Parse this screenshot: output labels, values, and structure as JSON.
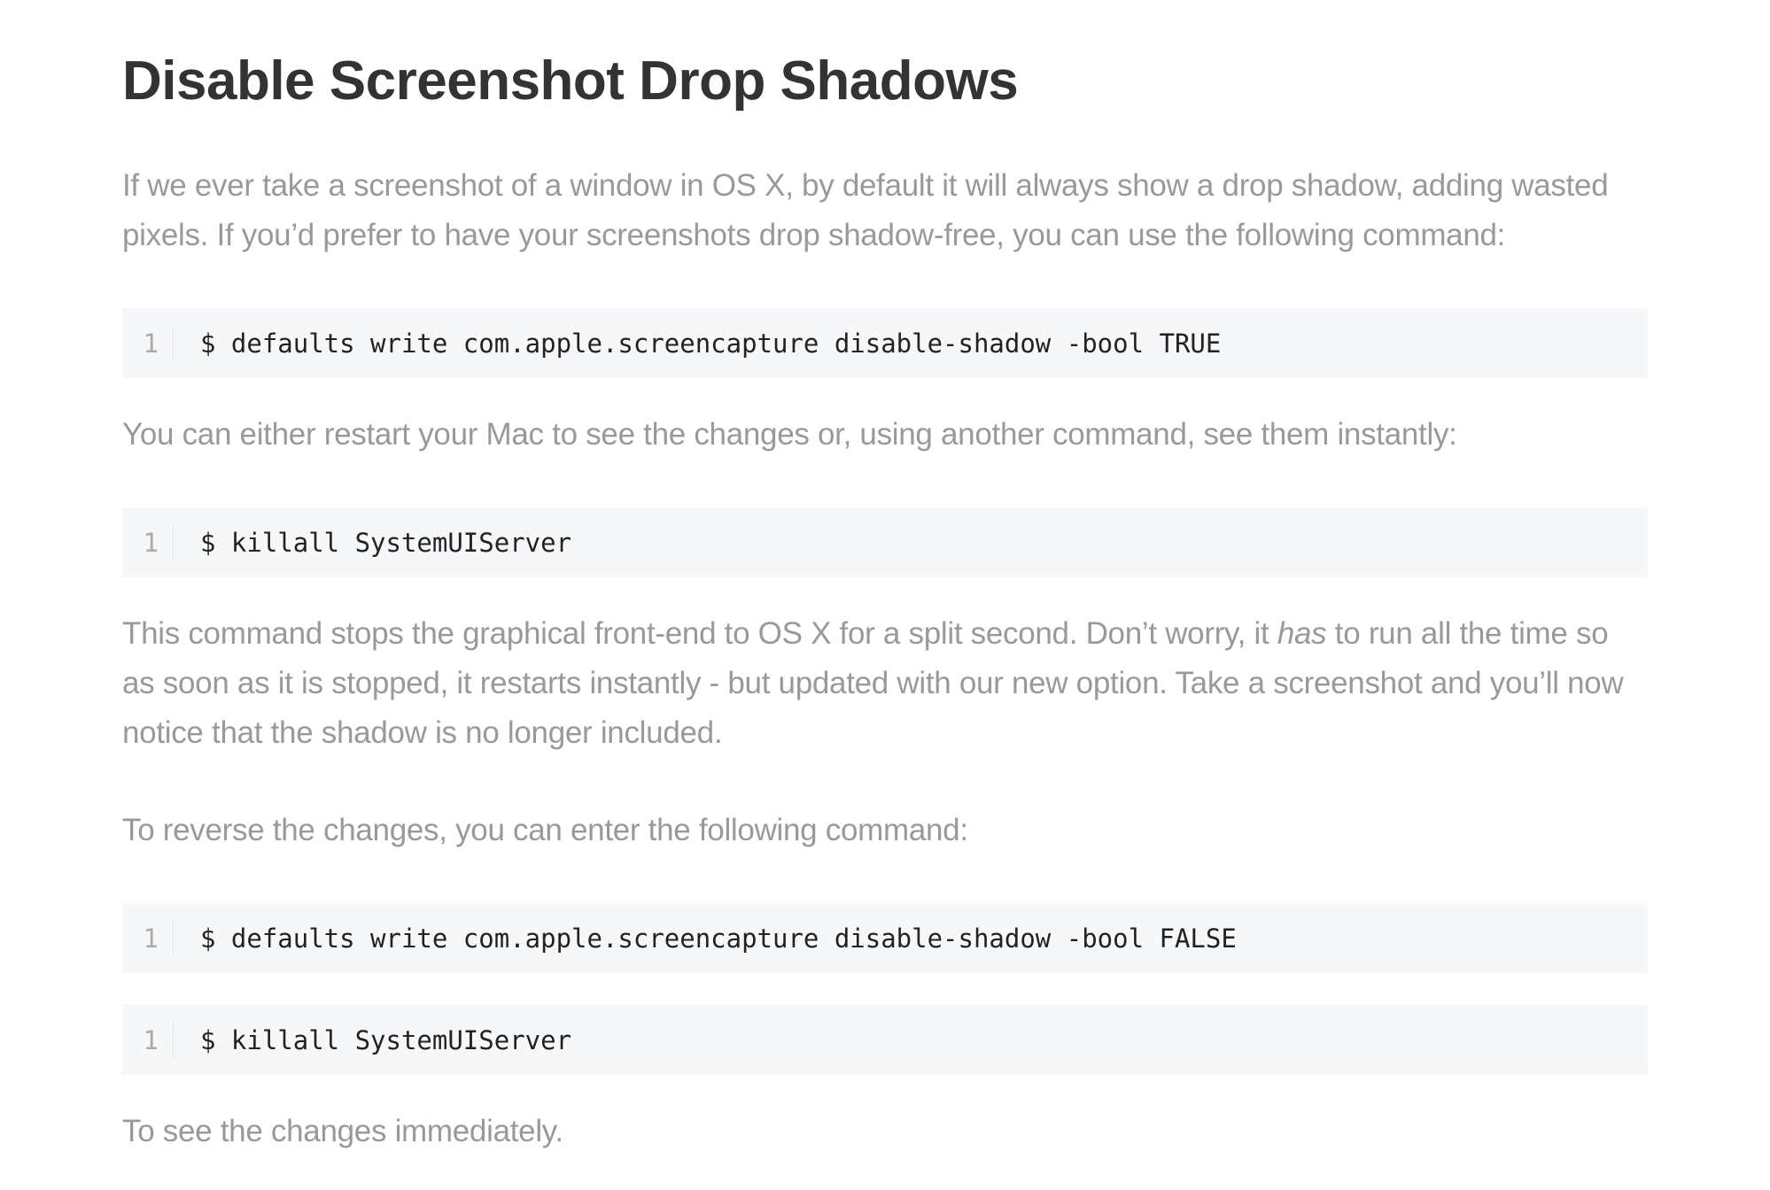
{
  "article": {
    "title": "Disable Screenshot Drop Shadows",
    "para1": "If we ever take a screenshot of a window in OS X, by default it will always show a drop shadow, adding wasted pixels. If you’d prefer to have your screenshots drop shadow-free, you can use the following command:",
    "code1": {
      "line_number": "1",
      "command": "$ defaults write com.apple.screencapture disable-shadow -bool TRUE"
    },
    "para2": "You can either restart your Mac to see the changes or, using another command, see them instantly:",
    "code2": {
      "line_number": "1",
      "command": "$ killall SystemUIServer"
    },
    "para3": {
      "before": "This command stops the graphical front-end to OS X for a split second. Don’t worry, it ",
      "emphasis": "has",
      "after": " to run all the time so as soon as it is stopped, it restarts instantly - but updated with our new option. Take a screenshot and you’ll now notice that the shadow is no longer included."
    },
    "para4": "To reverse the changes, you can enter the following command:",
    "code3": {
      "line_number": "1",
      "command": "$ defaults write com.apple.screencapture disable-shadow -bool FALSE"
    },
    "code4": {
      "line_number": "1",
      "command": "$ killall SystemUIServer"
    },
    "para5": "To see the changes immediately."
  },
  "colors": {
    "heading": "#333333",
    "body_text": "#999999",
    "code_background": "#f6f7f8",
    "code_text": "#222222",
    "line_number": "#aaaaaa"
  }
}
